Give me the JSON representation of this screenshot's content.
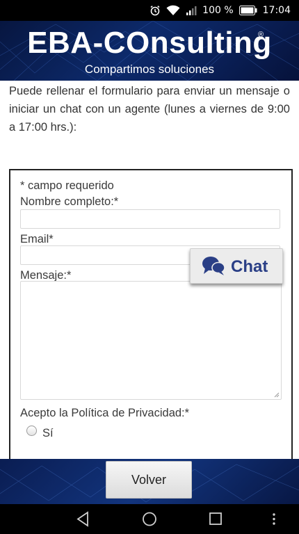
{
  "status_bar": {
    "battery_percent": "100 %",
    "time": "17:04",
    "icons": [
      "alarm-icon",
      "wifi-icon",
      "signal-icon",
      "battery-icon"
    ]
  },
  "header": {
    "brand_name": "EBA-COnsulting",
    "registered_mark": "®",
    "slogan": "Compartimos soluciones"
  },
  "intro_text": "Puede rellenar el formulario para enviar un mensaje o iniciar un chat con un agente (lunes a viernes de 9:00 a 17:00 hrs.):",
  "form": {
    "required_note": "* campo requerido",
    "name_label": "Nombre completo:*",
    "name_value": "",
    "email_label": "Email*",
    "email_value": "",
    "message_label": "Mensaje:*",
    "message_value": "",
    "privacy_label": "Acepto la Política de Privacidad:*",
    "privacy_option": "Sí",
    "privacy_checked": false
  },
  "chat_button": {
    "label": "Chat",
    "icon": "chat-bubbles-icon",
    "color": "#2a3f86"
  },
  "footer": {
    "back_label": "Volver"
  },
  "nav_bar": {
    "icons": [
      "back-icon",
      "home-icon",
      "recents-icon",
      "menu-icon"
    ]
  },
  "colors": {
    "header_bg": "#0d2a6b",
    "text": "#333333",
    "chat_accent": "#2a3f86"
  }
}
